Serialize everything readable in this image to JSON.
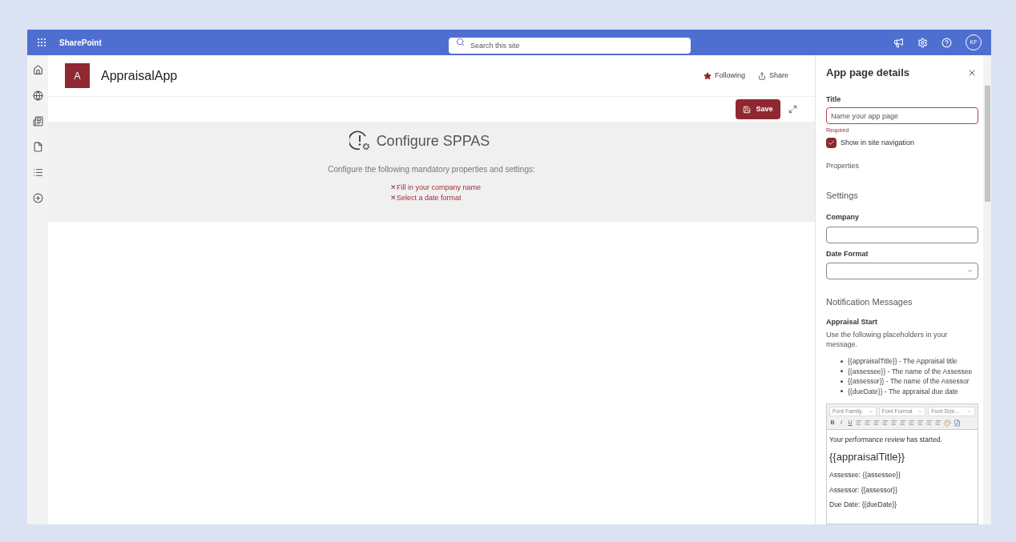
{
  "topbar": {
    "brand": "SharePoint",
    "search": {
      "placeholder": "Search this site"
    },
    "avatar": "KF"
  },
  "rail": {
    "items": [
      {
        "kind": "home"
      },
      {
        "kind": "globe"
      },
      {
        "kind": "news"
      },
      {
        "kind": "file"
      },
      {
        "kind": "list"
      },
      {
        "kind": "add"
      }
    ]
  },
  "site": {
    "logo": "A",
    "name": "AppraisalApp",
    "following": {
      "label": "Following",
      "on": true
    },
    "share": "Share"
  },
  "toolbar": {
    "save": "Save"
  },
  "notice": {
    "title": "Configure SPPAS",
    "text": "Configure the following mandatory properties and settings:",
    "marker": "✕",
    "items": [
      "Fill in your company name",
      "Select a date format"
    ]
  },
  "panel": {
    "title": "App page details",
    "title_label": "Title",
    "title_field": {
      "placeholder": "Name your app page"
    },
    "error": "Required",
    "show_nav": {
      "label": "Show in site navigation",
      "checked": true
    },
    "properties": "Properties",
    "settings": "Settings",
    "company": {
      "label": "Company"
    },
    "date_format": {
      "label": "Date Format"
    },
    "notifications": "Notification Messages",
    "appraisal_start": "Appraisal Start",
    "help": "Use the following placeholders in your message.",
    "placeholders": [
      "{{appraisalTitle}} - The Appraisal title",
      "{{assessee}} - The name of the Assessee",
      "{{assessor}} - The name of the Assessor",
      "{{dueDate}} - The appraisal due date"
    ],
    "editor": {
      "dropdowns": [
        "Font Family.",
        "Font Format",
        "Font Size..."
      ],
      "tools": [
        {
          "kind": "text",
          "label": "B"
        },
        {
          "kind": "text",
          "label": "I"
        },
        {
          "kind": "text",
          "label": "U"
        },
        {
          "kind": "icon"
        },
        {
          "kind": "icon"
        },
        {
          "kind": "icon"
        },
        {
          "kind": "icon"
        },
        {
          "kind": "icon"
        },
        {
          "kind": "icon"
        },
        {
          "kind": "icon"
        },
        {
          "kind": "icon"
        },
        {
          "kind": "icon"
        },
        {
          "kind": "icon"
        },
        {
          "kind": "icon"
        },
        {
          "kind": "icon"
        }
      ],
      "content": [
        {
          "kind": "paragraph",
          "text": "Your performance review has started."
        },
        {
          "kind": "heading",
          "text": "{{appraisalTitle}}"
        },
        {
          "kind": "paragraph",
          "text": "Assessee: {{assessee}}"
        },
        {
          "kind": "paragraph",
          "text": "Assessor: {{assessor}}"
        },
        {
          "kind": "paragraph",
          "text": "Due Date: {{dueDate}}"
        }
      ]
    }
  }
}
